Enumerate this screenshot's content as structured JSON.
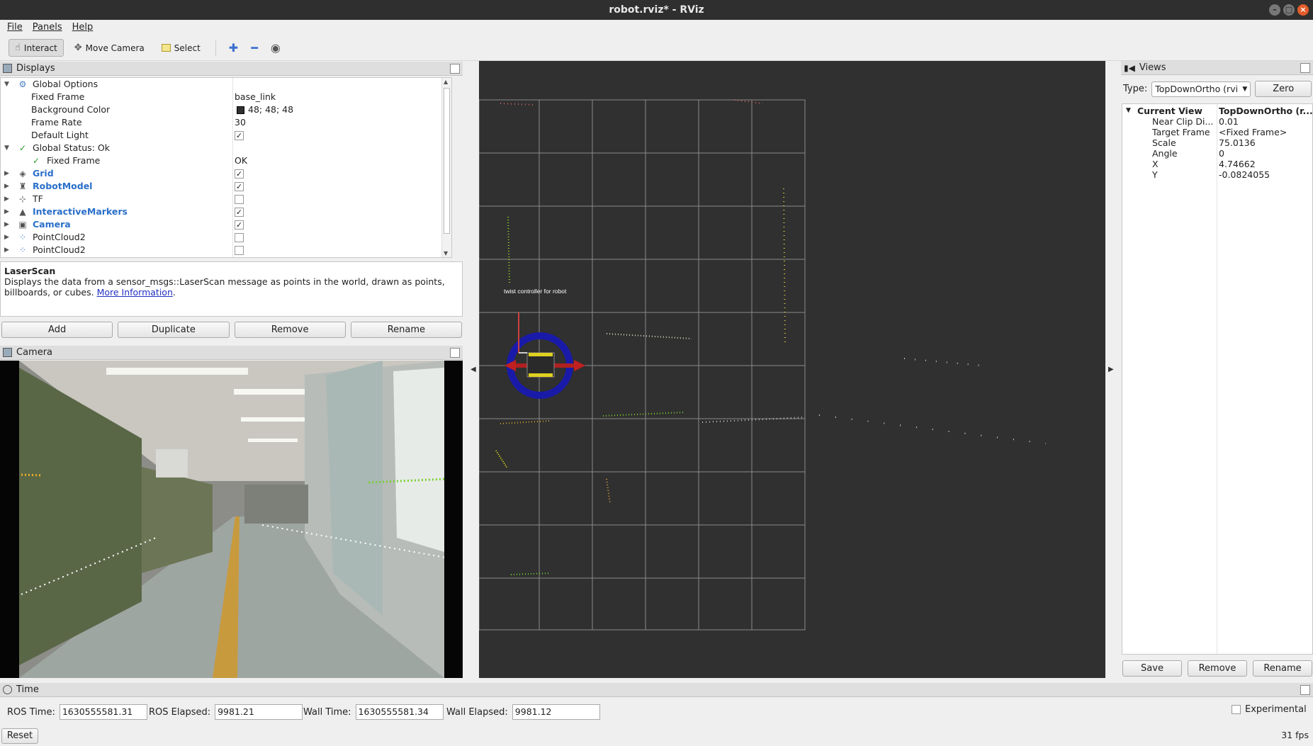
{
  "window": {
    "title": "robot.rviz* - RViz"
  },
  "menu": [
    "File",
    "Panels",
    "Help"
  ],
  "toolbar": {
    "interact": "Interact",
    "move_camera": "Move Camera",
    "select": "Select"
  },
  "displays": {
    "title": "Displays",
    "rows": [
      {
        "name": "Global Options",
        "value": ""
      },
      {
        "name": "Fixed Frame",
        "value": "base_link"
      },
      {
        "name": "Background Color",
        "value": "48; 48; 48"
      },
      {
        "name": "Frame Rate",
        "value": "30"
      },
      {
        "name": "Default Light",
        "value": ""
      },
      {
        "name": "Global Status: Ok",
        "value": ""
      },
      {
        "name": "Fixed Frame",
        "value": "OK"
      },
      {
        "name": "Grid",
        "value": ""
      },
      {
        "name": "RobotModel",
        "value": ""
      },
      {
        "name": "TF",
        "value": ""
      },
      {
        "name": "InteractiveMarkers",
        "value": ""
      },
      {
        "name": "Camera",
        "value": ""
      },
      {
        "name": "PointCloud2",
        "value": ""
      },
      {
        "name": "PointCloud2",
        "value": ""
      }
    ],
    "checks": {
      "default_light": true,
      "grid": true,
      "robotmodel": true,
      "tf": false,
      "interactivemarkers": true,
      "camera": true,
      "pc1": false,
      "pc2": false
    }
  },
  "description": {
    "title": "LaserScan",
    "text": "Displays the data from a sensor_msgs::LaserScan message as points in the world, drawn as points, billboards, or cubes.",
    "link": "More Information"
  },
  "display_buttons": {
    "add": "Add",
    "duplicate": "Duplicate",
    "remove": "Remove",
    "rename": "Rename"
  },
  "camera_panel": {
    "title": "Camera"
  },
  "viewport": {
    "label": "twist controller for robot",
    "background": "#303030"
  },
  "views": {
    "title": "Views",
    "type_label": "Type:",
    "type_value": "TopDownOrtho (rvi",
    "zero": "Zero",
    "current_view_label": "Current View",
    "current_view_value": "TopDownOrtho (r...",
    "props": [
      {
        "k": "Near Clip Di...",
        "v": "0.01"
      },
      {
        "k": "Target Frame",
        "v": "<Fixed Frame>"
      },
      {
        "k": "Scale",
        "v": "75.0136"
      },
      {
        "k": "Angle",
        "v": "0"
      },
      {
        "k": "X",
        "v": "4.74662"
      },
      {
        "k": "Y",
        "v": "-0.0824055"
      }
    ],
    "save": "Save",
    "remove": "Remove",
    "rename": "Rename"
  },
  "time": {
    "title": "Time",
    "ros_time_label": "ROS Time:",
    "ros_time": "1630555581.31",
    "ros_elapsed_label": "ROS Elapsed:",
    "ros_elapsed": "9981.21",
    "wall_time_label": "Wall Time:",
    "wall_time": "1630555581.34",
    "wall_elapsed_label": "Wall Elapsed:",
    "wall_elapsed": "9981.12",
    "experimental": "Experimental",
    "reset": "Reset",
    "fps": "31 fps"
  }
}
